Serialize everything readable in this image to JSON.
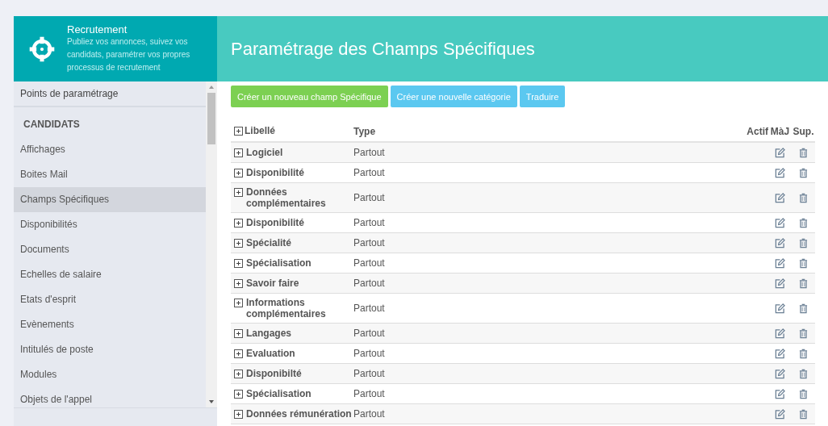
{
  "app": {
    "title": "Recrutement",
    "description": "Publiez vos annonces, suivez vos candidats, paramétrer vos propres processus de recrutement"
  },
  "page_title": "Paramétrage des Champs Spécifiques",
  "sidebar": {
    "top_item": "Points de paramétrage",
    "section": "CANDIDATS",
    "items": [
      {
        "label": "Affichages",
        "selected": false
      },
      {
        "label": "Boites Mail",
        "selected": false
      },
      {
        "label": "Champs Spécifiques",
        "selected": true
      },
      {
        "label": "Disponibilités",
        "selected": false
      },
      {
        "label": "Documents",
        "selected": false
      },
      {
        "label": "Echelles de salaire",
        "selected": false
      },
      {
        "label": "Etats d'esprit",
        "selected": false
      },
      {
        "label": "Evènements",
        "selected": false
      },
      {
        "label": "Intitulés de poste",
        "selected": false
      },
      {
        "label": "Modules",
        "selected": false
      },
      {
        "label": "Objets de l'appel",
        "selected": false
      }
    ]
  },
  "buttons": [
    {
      "label": "Créer un nouveau champ Spécifique",
      "kind": "success"
    },
    {
      "label": "Créer une nouvelle catégorie",
      "kind": "info"
    },
    {
      "label": "Traduire",
      "kind": "info"
    }
  ],
  "table": {
    "columns": [
      "Libellé",
      "Type",
      "Actif",
      "MàJ",
      "Sup."
    ],
    "rows": [
      {
        "label": "Logiciel",
        "type": "Partout"
      },
      {
        "label": "Disponibilité",
        "type": "Partout"
      },
      {
        "label": "Données complémentaires",
        "type": "Partout"
      },
      {
        "label": "Disponibilité",
        "type": "Partout"
      },
      {
        "label": "Spécialité",
        "type": "Partout"
      },
      {
        "label": "Spécialisation",
        "type": "Partout"
      },
      {
        "label": "Savoir faire",
        "type": "Partout"
      },
      {
        "label": "Informations complémentaires",
        "type": "Partout"
      },
      {
        "label": "Langages",
        "type": "Partout"
      },
      {
        "label": "Evaluation",
        "type": "Partout"
      },
      {
        "label": "Disponibilté",
        "type": "Partout"
      },
      {
        "label": "Spécialisation",
        "type": "Partout"
      },
      {
        "label": "Données rémunération",
        "type": "Partout"
      }
    ]
  }
}
